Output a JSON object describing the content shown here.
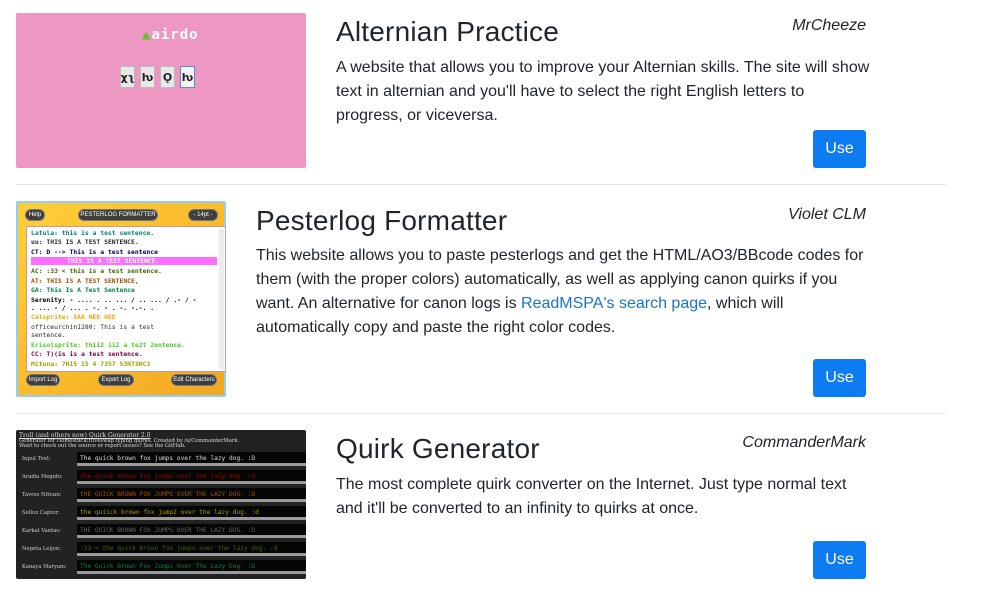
{
  "items": [
    {
      "title": "Alternian Practice",
      "author": "MrCheeze",
      "description": "A website that allows you to improve your Alternian skills. The site will show text in alternian and you'll have to select the right English letters to progress, or viceversa.",
      "button": "Use",
      "thumb": {
        "logo": "airdo",
        "logo_mark": "▲",
        "tiles": [
          "χʅ",
          "ƕ",
          "Ǫ",
          "ƕ"
        ]
      }
    },
    {
      "title": "Pesterlog Formatter",
      "author": "Violet CLM",
      "description_before": "This website allows you to paste pesterlogs and get the HTML/AO3/BBcode codes for them (with the proper colors) automatically, as well as applying canon quirks if you want. An alternative for canon logs is ",
      "link": "ReadMSPA's search page",
      "description_after": ", which will automatically copy and paste the right color codes.",
      "button": "Use",
      "thumb": {
        "help": "Help",
        "header": "PESTERLOG FORMATTER",
        "size": "- 14pt -",
        "import": "Import Log",
        "export": "Export Log",
        "edit": "Edit Characters",
        "lines": [
          {
            "text": "Latula: this is a test sentence.",
            "color": "#008080"
          },
          {
            "text": "uu: THIS IS A TEST SENTENCE.",
            "color": "#2b2b2b"
          },
          {
            "text": "CT: D --> This is a test sentence",
            "color": "#000056"
          },
          {
            "text": "THIS IS A TEST SENTENCE.",
            "color": "#ffffff"
          },
          {
            "text": "AC: :33 < this is a test sentence.",
            "color": "#416600"
          },
          {
            "text": "AT: THIS IS A TEST SENTENCE,",
            "color": "#a15000"
          },
          {
            "text": "GA: This Is A Test Sentence",
            "color": "#008141"
          },
          {
            "text": "Serenity: - .... . .. ... / .. ... / .- / -",
            "color": "#000000"
          },
          {
            "text": ". ... - / ... . -. - . -. -.-. .",
            "color": "#000000"
          },
          {
            "text": "Calsprite: SAA HEE HEE",
            "color": "#f2a400"
          },
          {
            "text": "officeurchin1280: This is a test",
            "color": "#2b2b2b"
          },
          {
            "text": "sentence.",
            "color": "#2b2b2b"
          },
          {
            "text": "Erisolsprite: thii2 ii2 a te2t 2entence.",
            "color": "#4ac925"
          },
          {
            "text": "CC: T)(is is a test sentence.",
            "color": "#77003c"
          },
          {
            "text": "Mituna: 7H15 15 4 7357 53N73NC3",
            "color": "#a1a100"
          }
        ]
      }
    },
    {
      "title": "Quirk Generator",
      "author": "CommanderMark",
      "description": "The most complete quirk converter on the Internet. Just type normal text and it'll be converted to an infinity to quirks at once.",
      "button": "Use",
      "thumb": {
        "header_1": "Troll (and others now) Quirk Generator 2.0",
        "header_2": "Generator for Homestuck/Hiveswap typing quirks. Created by /u/CommanderMark.",
        "header_3": "Want to check out the source or report issues? See the GitHub.",
        "rows": [
          {
            "label": "Input Text:",
            "text": "The quick brown fox jumps over the lazy dog. :D",
            "color": "#dddddd"
          },
          {
            "label": "Aradia Megido:",
            "text": "the quick brown fox jumps over the lazy dog. :d",
            "color": "#a10000"
          },
          {
            "label": "Tavros Nitram:",
            "text": "tHE QUICK BROWN FOX JUMPS OVER THE LAZY DOG. :D",
            "color": "#a15000"
          },
          {
            "label": "Sollux Captor:",
            "text": "the quiick brown fox jump2 over the lazy dog. :d",
            "color": "#a1a100"
          },
          {
            "label": "Karkat Vantas:",
            "text": "THE QUICK BROWN FOX JUMPS OVER THE LAZY DOG. :D",
            "color": "#626262"
          },
          {
            "label": "Nepeta Leijon:",
            "text": ":33 < the quick brown fox jumps over the lazy dog. :d",
            "color": "#416600"
          },
          {
            "label": "Kanaya Maryam:",
            "text": "The Quick Brown Fox Jumps Over The Lazy Dog. :D",
            "color": "#008141"
          }
        ]
      }
    }
  ]
}
